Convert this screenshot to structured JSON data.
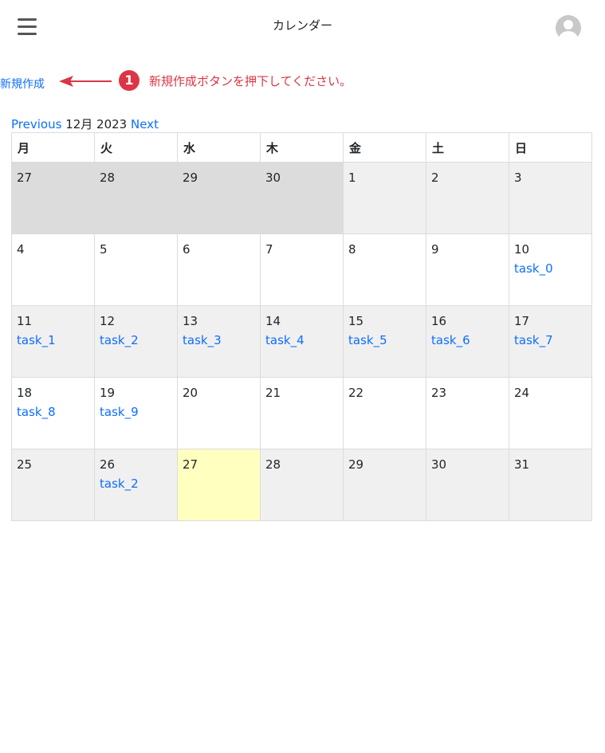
{
  "header": {
    "title": "カレンダー",
    "menu_icon": "hamburger-icon",
    "avatar_icon": "user-avatar-icon"
  },
  "annotation": {
    "new_link": "新規作成",
    "step": "1",
    "text": "新規作成ボタンを押下してください。",
    "color": "#dc3545"
  },
  "nav": {
    "prev": "Previous",
    "month": "12月 2023",
    "next": "Next"
  },
  "calendar": {
    "weekdays": [
      "月",
      "火",
      "水",
      "木",
      "金",
      "土",
      "日"
    ],
    "weeks": [
      [
        {
          "day": "27",
          "prev": true
        },
        {
          "day": "28",
          "prev": true
        },
        {
          "day": "29",
          "prev": true
        },
        {
          "day": "30",
          "prev": true
        },
        {
          "day": "1"
        },
        {
          "day": "2"
        },
        {
          "day": "3"
        }
      ],
      [
        {
          "day": "4"
        },
        {
          "day": "5"
        },
        {
          "day": "6"
        },
        {
          "day": "7"
        },
        {
          "day": "8"
        },
        {
          "day": "9"
        },
        {
          "day": "10",
          "task": "task_0"
        }
      ],
      [
        {
          "day": "11",
          "task": "task_1"
        },
        {
          "day": "12",
          "task": "task_2"
        },
        {
          "day": "13",
          "task": "task_3"
        },
        {
          "day": "14",
          "task": "task_4"
        },
        {
          "day": "15",
          "task": "task_5"
        },
        {
          "day": "16",
          "task": "task_6"
        },
        {
          "day": "17",
          "task": "task_7"
        }
      ],
      [
        {
          "day": "18",
          "task": "task_8"
        },
        {
          "day": "19",
          "task": "task_9"
        },
        {
          "day": "20"
        },
        {
          "day": "21"
        },
        {
          "day": "22"
        },
        {
          "day": "23"
        },
        {
          "day": "24"
        }
      ],
      [
        {
          "day": "25"
        },
        {
          "day": "26",
          "task": "task_2"
        },
        {
          "day": "27",
          "today": true
        },
        {
          "day": "28"
        },
        {
          "day": "29"
        },
        {
          "day": "30"
        },
        {
          "day": "31"
        }
      ]
    ],
    "colors": {
      "link": "#0d6efd",
      "prev_month_bg": "#dcdcdc",
      "alt_row_bg": "#f0f0f0",
      "today_bg": "#ffffc0"
    }
  }
}
